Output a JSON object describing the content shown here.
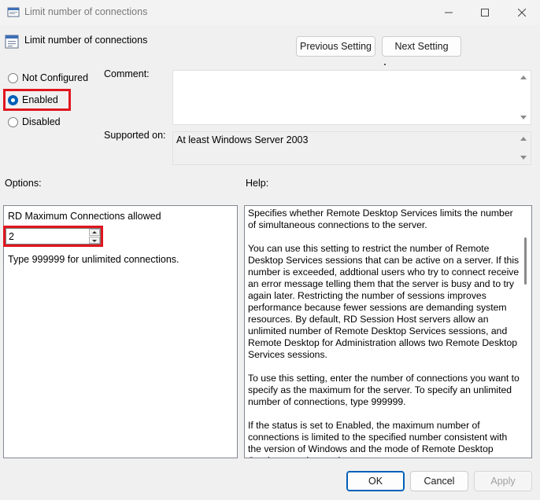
{
  "window": {
    "title": "Limit number of connections"
  },
  "header": {
    "title": "Limit number of connections",
    "previous_setting": "Previous Setting",
    "next_setting": "Next Setting"
  },
  "state": {
    "options": [
      {
        "label": "Not Configured",
        "selected": false
      },
      {
        "label": "Enabled",
        "selected": true
      },
      {
        "label": "Disabled",
        "selected": false
      }
    ]
  },
  "comment": {
    "label": "Comment:",
    "value": ""
  },
  "supported": {
    "label": "Supported on:",
    "value": "At least Windows Server 2003"
  },
  "options_section": {
    "label": "Options:",
    "field_label": "RD Maximum Connections allowed",
    "field_value": "2",
    "hint": "Type 999999 for unlimited connections."
  },
  "help_section": {
    "label": "Help:",
    "paragraphs": [
      "Specifies whether Remote Desktop Services limits the number of simultaneous connections to the server.",
      "You can use this setting to restrict the number of Remote Desktop Services sessions that can be active on a server. If this number is exceeded, addtional users who try to connect receive an error message telling them that the server is busy and to try again later. Restricting the number of sessions improves performance because fewer sessions are demanding system resources. By default, RD Session Host servers allow an unlimited number of Remote Desktop Services sessions, and Remote Desktop for Administration allows two Remote Desktop Services sessions.",
      "To use this setting, enter the number of connections you want to specify as the maximum for the server. To specify an unlimited number of connections, type 999999.",
      "If the status is set to Enabled, the maximum number of connections is limited to the specified number consistent with the version of Windows and the mode of Remote Desktop Services running on the server."
    ]
  },
  "footer": {
    "ok": "OK",
    "cancel": "Cancel",
    "apply": "Apply"
  },
  "colors": {
    "highlight": "#e0161f",
    "accent": "#005fb8"
  }
}
